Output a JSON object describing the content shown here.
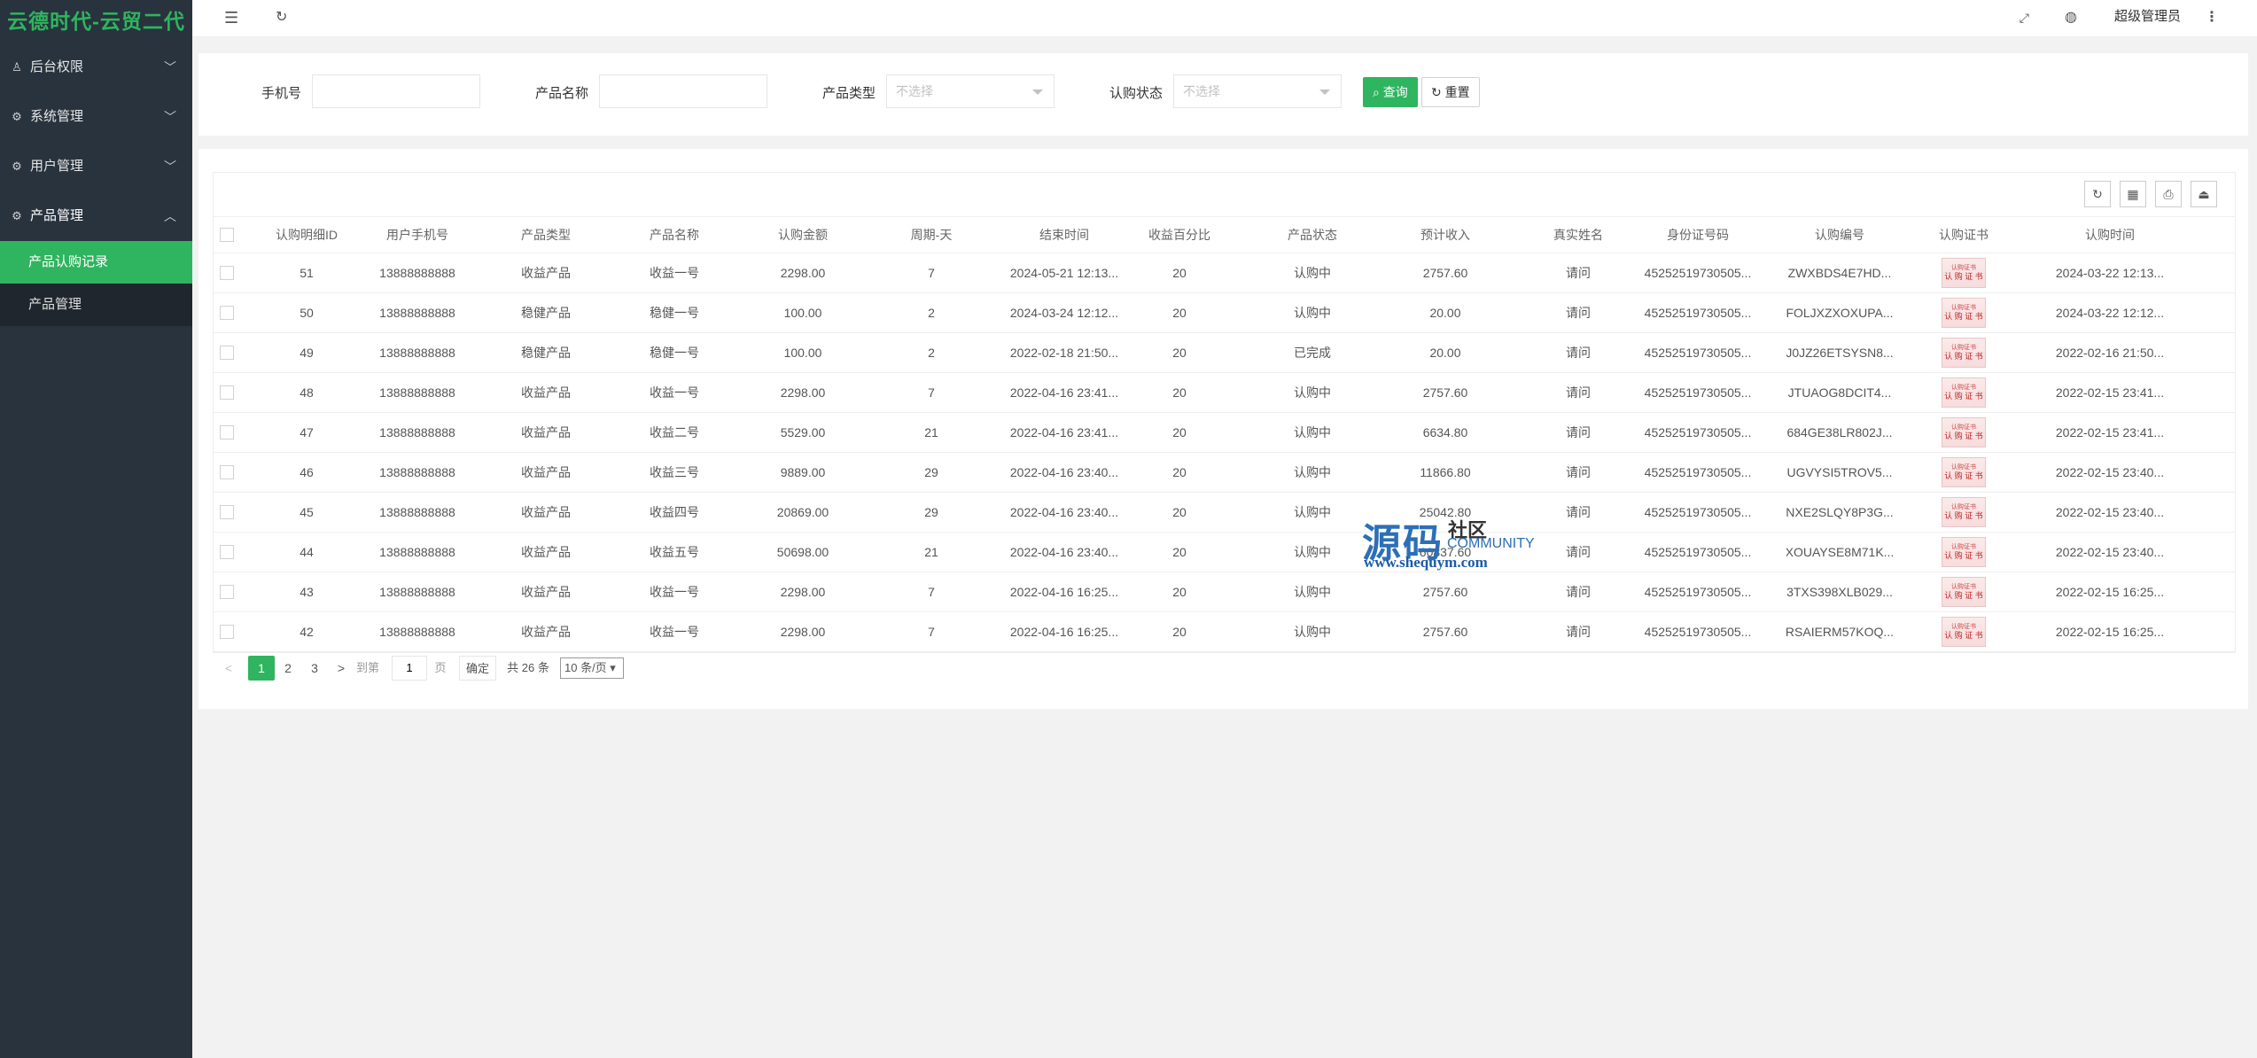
{
  "app": {
    "title": "云德时代-云贸二代"
  },
  "sidebar": {
    "items": [
      {
        "label": "后台权限",
        "icon": "user-icon",
        "chevron": "chevron-down-icon"
      },
      {
        "label": "系统管理",
        "icon": "gear-icon",
        "chevron": "chevron-down-icon"
      },
      {
        "label": "用户管理",
        "icon": "gear-icon",
        "chevron": "chevron-down-icon"
      },
      {
        "label": "产品管理",
        "icon": "gear-icon",
        "chevron": "chevron-up-icon"
      }
    ],
    "subitems": [
      {
        "label": "产品认购记录",
        "active": true
      },
      {
        "label": "产品管理",
        "active": false
      }
    ]
  },
  "header": {
    "admin_name": "超级管理员",
    "icons": [
      "menu-fold-icon",
      "refresh-icon",
      "fullscreen-icon",
      "globe-icon",
      "more-icon"
    ]
  },
  "search": {
    "phone_label": "手机号",
    "phone_value": "",
    "product_name_label": "产品名称",
    "product_name_value": "",
    "product_type_label": "产品类型",
    "product_type_placeholder": "不选择",
    "status_label": "认购状态",
    "status_placeholder": "不选择",
    "query_label": "查询",
    "reset_label": "重置"
  },
  "table": {
    "columns": [
      "认购明细ID",
      "用户手机号",
      "产品类型",
      "产品名称",
      "认购金额",
      "周期-天",
      "结束时间",
      "收益百分比",
      "产品状态",
      "预计收入",
      "真实姓名",
      "身份证号码",
      "认购编号",
      "认购证书",
      "认购时间"
    ],
    "certificate": {
      "top": "认购证书",
      "main": "认 购 证 书"
    },
    "rows": [
      [
        "51",
        "13888888888",
        "收益产品",
        "收益一号",
        "2298.00",
        "7",
        "2024-05-21 12:13...",
        "20",
        "认购中",
        "2757.60",
        "请问",
        "45252519730505...",
        "ZWXBDS4E7HD...",
        "",
        "2024-03-22 12:13..."
      ],
      [
        "50",
        "13888888888",
        "稳健产品",
        "稳健一号",
        "100.00",
        "2",
        "2024-03-24 12:12...",
        "20",
        "认购中",
        "20.00",
        "请问",
        "45252519730505...",
        "FOLJXZXOXUPA...",
        "",
        "2024-03-22 12:12..."
      ],
      [
        "49",
        "13888888888",
        "稳健产品",
        "稳健一号",
        "100.00",
        "2",
        "2022-02-18 21:50...",
        "20",
        "已完成",
        "20.00",
        "请问",
        "45252519730505...",
        "J0JZ26ETSYSN8...",
        "",
        "2022-02-16 21:50..."
      ],
      [
        "48",
        "13888888888",
        "收益产品",
        "收益一号",
        "2298.00",
        "7",
        "2022-04-16 23:41...",
        "20",
        "认购中",
        "2757.60",
        "请问",
        "45252519730505...",
        "JTUAOG8DCIT4...",
        "",
        "2022-02-15 23:41..."
      ],
      [
        "47",
        "13888888888",
        "收益产品",
        "收益二号",
        "5529.00",
        "21",
        "2022-04-16 23:41...",
        "20",
        "认购中",
        "6634.80",
        "请问",
        "45252519730505...",
        "684GE38LR802J...",
        "",
        "2022-02-15 23:41..."
      ],
      [
        "46",
        "13888888888",
        "收益产品",
        "收益三号",
        "9889.00",
        "29",
        "2022-04-16 23:40...",
        "20",
        "认购中",
        "11866.80",
        "请问",
        "45252519730505...",
        "UGVYSI5TROV5...",
        "",
        "2022-02-15 23:40..."
      ],
      [
        "45",
        "13888888888",
        "收益产品",
        "收益四号",
        "20869.00",
        "29",
        "2022-04-16 23:40...",
        "20",
        "认购中",
        "25042.80",
        "请问",
        "45252519730505...",
        "NXE2SLQY8P3G...",
        "",
        "2022-02-15 23:40..."
      ],
      [
        "44",
        "13888888888",
        "收益产品",
        "收益五号",
        "50698.00",
        "21",
        "2022-04-16 23:40...",
        "20",
        "认购中",
        "60837.60",
        "请问",
        "45252519730505...",
        "XOUAYSE8M71K...",
        "",
        "2022-02-15 23:40..."
      ],
      [
        "43",
        "13888888888",
        "收益产品",
        "收益一号",
        "2298.00",
        "7",
        "2022-04-16 16:25...",
        "20",
        "认购中",
        "2757.60",
        "请问",
        "45252519730505...",
        "3TXS398XLB029...",
        "",
        "2022-02-15 16:25..."
      ],
      [
        "42",
        "13888888888",
        "收益产品",
        "收益一号",
        "2298.00",
        "7",
        "2022-04-16 16:25...",
        "20",
        "认购中",
        "2757.60",
        "请问",
        "45252519730505...",
        "RSAIERM57KOQ...",
        "",
        "2022-02-15 16:25..."
      ]
    ]
  },
  "pagination": {
    "prev": "<",
    "pages": [
      "1",
      "2",
      "3"
    ],
    "current": "1",
    "next": ">",
    "goto_label": "到第",
    "goto_value": "1",
    "page_suffix": "页",
    "confirm_label": "确定",
    "total_label": "共 26 条",
    "page_size_label": "10 条/页"
  },
  "watermark": {
    "big": "源码",
    "small": "社区",
    "community": "COMMUNITY",
    "url": "www.shequym.com"
  },
  "colors": {
    "accent": "#2fb45f",
    "sidebar": "#28333e",
    "sidebar_sub": "#1f262d"
  }
}
